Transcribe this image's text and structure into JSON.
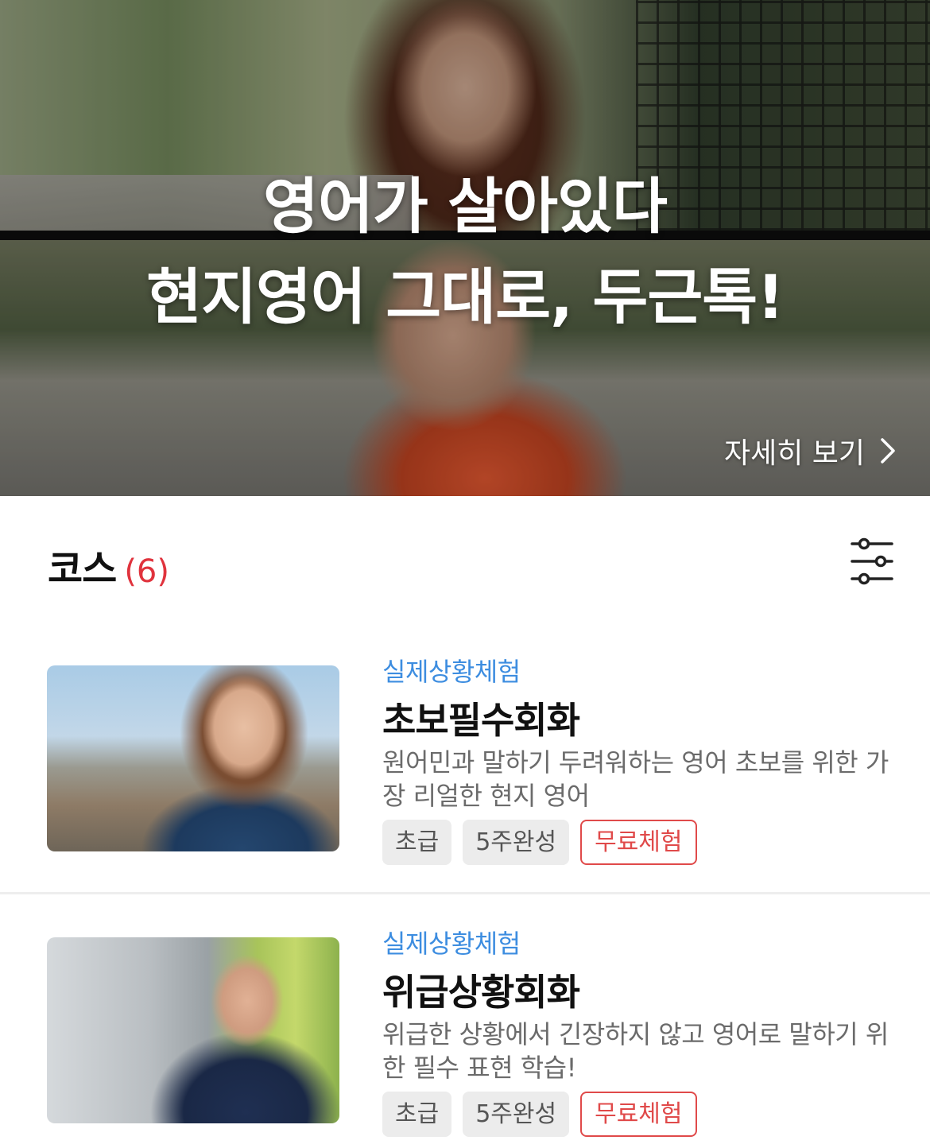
{
  "hero": {
    "line1": "영어가 살아있다",
    "line2": "현지영어 그대로, 두근톡!",
    "detail_link": "자세히 보기"
  },
  "courses_section": {
    "title": "코스",
    "count": "(6)"
  },
  "courses": [
    {
      "category": "실제상황체험",
      "title": "초보필수회화",
      "description": "원어민과 말하기 두려워하는 영어 초보를 위한 가장 리얼한 현지 영어",
      "tags": [
        "초급",
        "5주완성",
        "무료체험"
      ]
    },
    {
      "category": "실제상황체험",
      "title": "위급상황회화",
      "description": "위급한 상황에서 긴장하지 않고 영어로 말하기 위한 필수 표현 학습!",
      "tags": [
        "초급",
        "5주완성",
        "무료체험"
      ]
    }
  ],
  "colors": {
    "accent_blue": "#3d8de0",
    "count_red": "#e0333d",
    "free_tag_red": "#e04a4a"
  },
  "icons": {
    "detail_arrow": "chevron-right-icon",
    "filter": "sliders-icon"
  }
}
